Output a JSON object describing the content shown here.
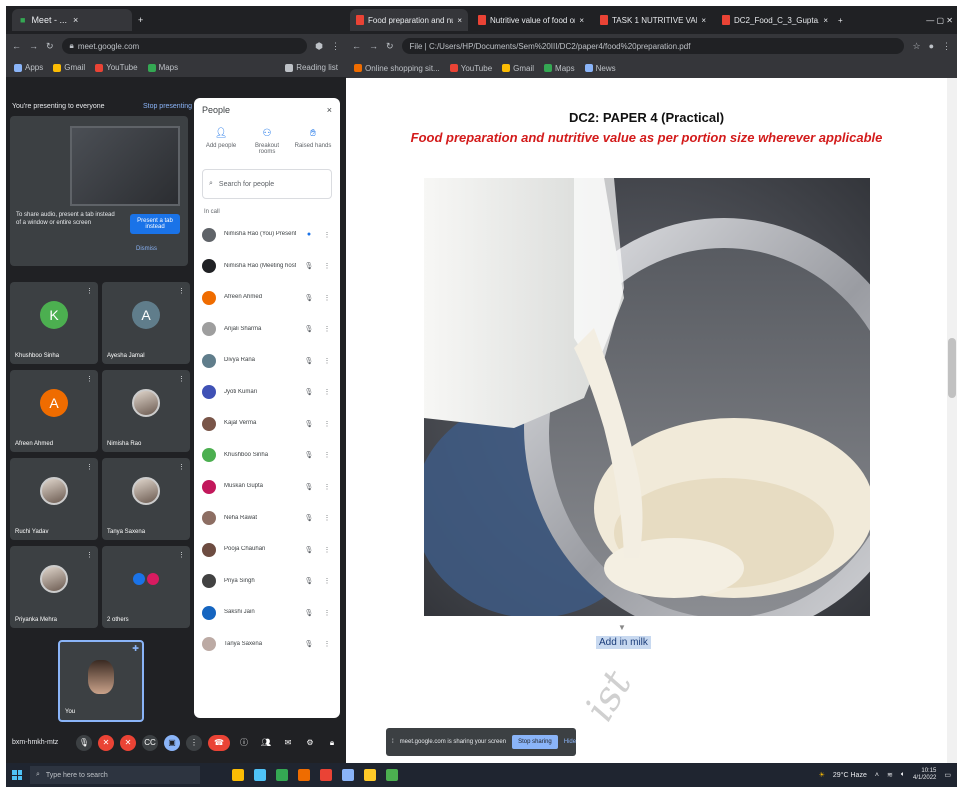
{
  "left_window": {
    "tab": {
      "title": "Meet - ...",
      "close": "×"
    },
    "new_tab": "+",
    "url": "meet.google.com",
    "bookmarks": [
      {
        "label": "Apps",
        "color": "#8ab4f8"
      },
      {
        "label": "Gmail",
        "color": "#fbbc04"
      },
      {
        "label": "YouTube",
        "color": "#ea4335"
      },
      {
        "label": "Maps",
        "color": "#34a853"
      },
      {
        "label": "Reading list",
        "color": "#bdc1c6"
      }
    ],
    "meet": {
      "presenting_banner": "You're presenting to everyone",
      "stop_presenting": "Stop presenting",
      "present_note": "To share audio, present a tab instead of a window or entire screen",
      "present_button": "Present a tab instead",
      "dismiss": "Dismiss",
      "tiles": [
        {
          "name": "Khushboo Sinha",
          "initial": "K",
          "color": "#4caf50",
          "photo": false
        },
        {
          "name": "Ayesha Jamal",
          "initial": "A",
          "color": "#607d8b",
          "photo": false
        },
        {
          "name": "Afreen Ahmed",
          "initial": "A",
          "color": "#ef6c00",
          "photo": false
        },
        {
          "name": "Nimisha Rao",
          "initial": "",
          "color": "",
          "photo": true
        },
        {
          "name": "Ruchi Yadav",
          "initial": "",
          "color": "",
          "photo": true
        },
        {
          "name": "Tanya Saxena",
          "initial": "",
          "color": "",
          "photo": true
        },
        {
          "name": "Priyanka Mehra",
          "initial": "",
          "color": "",
          "photo": true
        },
        {
          "name": "2 others",
          "initial": "",
          "color": "",
          "photo": false
        }
      ],
      "self_name": "You",
      "people_panel": {
        "title": "People",
        "close": "×",
        "actions": [
          {
            "icon": "add-person",
            "label": "Add people"
          },
          {
            "icon": "groups",
            "label": "Breakout rooms"
          },
          {
            "icon": "hand",
            "label": "Raised hands"
          }
        ],
        "search_placeholder": "Search for people",
        "section": "In call",
        "participants": [
          {
            "name": "Nimisha Rao (You) Presentation",
            "color": "#5f6368"
          },
          {
            "name": "Nimisha Rao (Meeting host)",
            "color": "#202124"
          },
          {
            "name": "Afreen Ahmed",
            "color": "#ef6c00"
          },
          {
            "name": "Anjali Sharma",
            "color": "#9e9e9e"
          },
          {
            "name": "Divya Rana",
            "color": "#607d8b"
          },
          {
            "name": "Jyoti Kumari",
            "color": "#3f51b5"
          },
          {
            "name": "Kajal Verma",
            "color": "#795548"
          },
          {
            "name": "Khushboo Sinha",
            "color": "#4caf50"
          },
          {
            "name": "Muskan Gupta",
            "color": "#c2185b"
          },
          {
            "name": "Neha Rawat",
            "color": "#8d6e63"
          },
          {
            "name": "Pooja Chauhan",
            "color": "#6d4c41"
          },
          {
            "name": "Priya Singh",
            "color": "#424242"
          },
          {
            "name": "Sakshi Jain",
            "color": "#1565c0"
          },
          {
            "name": "Tanya Saxena",
            "color": "#bcaaa4"
          }
        ]
      },
      "meeting_code": "bxm-hmkh-mtz"
    }
  },
  "right_window": {
    "tabs": [
      {
        "title": "Food preparation and nutritive...",
        "active": true
      },
      {
        "title": "Nutritive value of food on...",
        "active": false
      },
      {
        "title": "TASK 1 NUTRITIVE VALUE...",
        "active": false
      },
      {
        "title": "DC2_Food_C_3_Gupta.pdf",
        "active": false
      }
    ],
    "url": "File | C:/Users/HP/Documents/Sem%20III/DC2/paper4/food%20preparation.pdf",
    "bookmarks": [
      {
        "label": "Online shopping sit...",
        "color": "#ef6c00"
      },
      {
        "label": "YouTube",
        "color": "#ea4335"
      },
      {
        "label": "Gmail",
        "color": "#fbbc04"
      },
      {
        "label": "Maps",
        "color": "#34a853"
      },
      {
        "label": "News",
        "color": "#8ab4f8"
      }
    ],
    "document": {
      "title": "DC2: PAPER 4 (Practical)",
      "subtitle": "Food preparation and nutritive value as per portion size wherever applicable",
      "caption": "Add in milk",
      "watermark": "ist",
      "share_bar": {
        "text": "meet.google.com is sharing your screen",
        "stop": "Stop sharing",
        "hide": "Hide"
      }
    }
  },
  "taskbar": {
    "search_placeholder": "Type here to search",
    "apps": [
      "#fbbc04",
      "#4fc3f7",
      "#34a853",
      "#ef6c00",
      "#ea4335",
      "#8ab4f8",
      "#ffca28",
      "#4caf50"
    ],
    "weather": "29°C Haze",
    "time": "10:15",
    "date": "4/1/2022"
  }
}
